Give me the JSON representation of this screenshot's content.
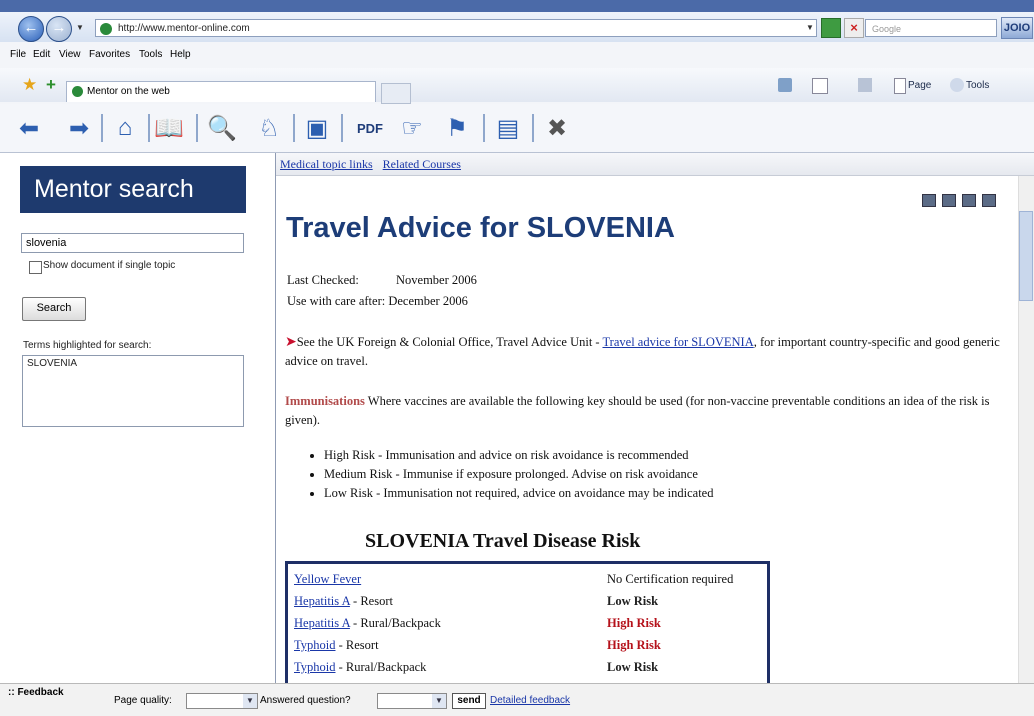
{
  "browser": {
    "url": "http://www.mentor-online.com",
    "search_placeholder": "Google",
    "go_label": "JOIO",
    "menu": [
      "File",
      "Edit",
      "View",
      "Favorites",
      "Tools",
      "Help"
    ],
    "tab_title": "Mentor on the web",
    "commands": {
      "page": "Page",
      "tools": "Tools"
    }
  },
  "app_toolbar": {
    "icons": [
      "back-arrow-icon",
      "forward-arrow-icon",
      "home-icon",
      "book-icon",
      "zoom-search-icon",
      "person-search-icon",
      "image-icon",
      "pdf-icon",
      "pointer-icon",
      "flag-icon",
      "document-icon",
      "tools-icon"
    ],
    "pdf_label": "PDF"
  },
  "sidebar": {
    "title": "Mentor search",
    "search_value": "slovenia",
    "checkbox_label": "Show document if single topic",
    "search_button": "Search",
    "terms_label": "Terms highlighted for search:",
    "terms_value": "SLOVENIA"
  },
  "linkbar": {
    "medical_topic_links": "Medical topic links",
    "related_courses": "Related Courses"
  },
  "content": {
    "title": "Travel Advice for SLOVENIA",
    "last_checked_label": "Last Checked:",
    "last_checked_value": "November 2006",
    "use_with_care": "Use with care after: December 2006",
    "fco_intro": "See the UK Foreign & Colonial Office, Travel Advice Unit - ",
    "fco_link": "Travel advice for SLOVENIA",
    "fco_rest": ", for important country-specific and good generic advice on travel.",
    "immunisations_label": "Immunisations",
    "immunisations_text": " Where vaccines are available the following key should be used (for non-vaccine preventable conditions an idea of the risk is given).",
    "risk_key": [
      "High Risk - Immunisation and advice on risk avoidance is recommended",
      "Medium Risk - Immunise if exposure prolonged. Advise on risk avoidance",
      "Low Risk - Immunisation not required, advice on avoidance may be indicated"
    ],
    "table_title": "SLOVENIA Travel Disease Risk",
    "table_rows": [
      {
        "disease": "Yellow Fever",
        "suffix": "",
        "risk": "No Certification required",
        "level": "none"
      },
      {
        "disease": "Hepatitis A",
        "suffix": " - Resort",
        "risk": "Low Risk",
        "level": "low"
      },
      {
        "disease": "Hepatitis A",
        "suffix": " - Rural/Backpack",
        "risk": "High Risk",
        "level": "high"
      },
      {
        "disease": "Typhoid",
        "suffix": " - Resort",
        "risk": "High Risk",
        "level": "high"
      },
      {
        "disease": "Typhoid",
        "suffix": " - Rural/Backpack",
        "risk": "Low Risk",
        "level": "low"
      }
    ]
  },
  "footer": {
    "feedback": ":: Feedback",
    "page_quality_label": "Page quality:",
    "answered_label": "Answered question?",
    "send_label": "send",
    "detailed_feedback": "Detailed feedback"
  }
}
